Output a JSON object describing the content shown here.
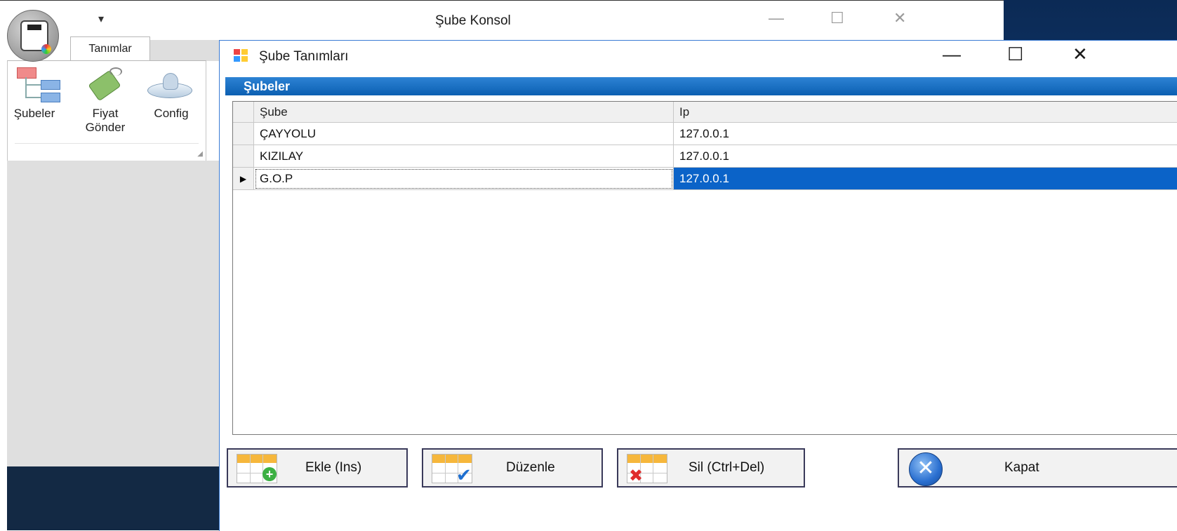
{
  "app": {
    "title": "Şube Konsol",
    "controls": {
      "minimize": "—",
      "maximize": "☐",
      "close": "✕"
    },
    "quick_access": "▾"
  },
  "ribbon": {
    "tab": "Tanımlar",
    "items": [
      {
        "label": "Şubeler",
        "icon": "org-tree-icon"
      },
      {
        "label": "Fiyat Gönder",
        "icon": "price-tag-icon"
      },
      {
        "label": "Config",
        "icon": "config-icon"
      }
    ]
  },
  "window": {
    "title": "Şube Tanımları",
    "controls": {
      "minimize": "—",
      "maximize": "☐",
      "close": "✕"
    },
    "group_header": "Şubeler"
  },
  "grid": {
    "columns": [
      "Şube",
      "Ip"
    ],
    "rows": [
      {
        "sube": "ÇAYYOLU",
        "ip": "127.0.0.1"
      },
      {
        "sube": "KIZILAY",
        "ip": "127.0.0.1"
      },
      {
        "sube": "G.O.P",
        "ip": "127.0.0.1",
        "selected": true
      }
    ],
    "current_row_marker": "▶"
  },
  "buttons": {
    "add": "Ekle (Ins)",
    "edit": "Düzenle",
    "delete": "Sil (Ctrl+Del)",
    "close": "Kapat"
  },
  "colors": {
    "accent": "#0b63c8",
    "header_blue": "#1a6fc4",
    "grid_icon_orange": "#f6b73c"
  }
}
